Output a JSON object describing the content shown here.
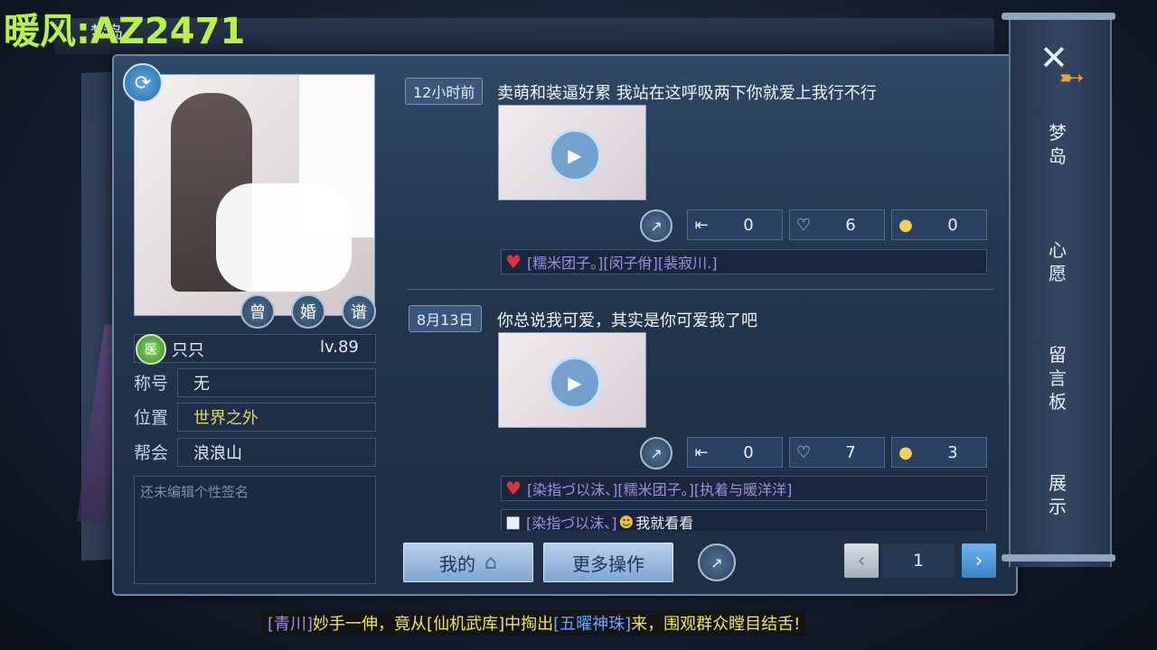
{
  "watermark": "暖风:AZ2471",
  "top_tab": "梦岛",
  "profile": {
    "sync_icon": "refresh-icon",
    "photo_buttons": [
      "曾",
      "婚",
      "谱"
    ],
    "name": "只只",
    "school_badge": "医",
    "level": "lv.89",
    "title_label": "称号",
    "title_value": "无",
    "location_label": "位置",
    "location_value": "世界之外",
    "guild_label": "帮会",
    "guild_value": "浪浪山",
    "signature_placeholder": "还未编辑个性签名"
  },
  "posts": [
    {
      "time": "12小时前",
      "text": "卖萌和装逼好累 我站在这呼吸两下你就爱上我行不行",
      "stats": {
        "forward": "0",
        "likes": "6",
        "comments": "0"
      },
      "liked_by": "[糯米团子。][闵子佾][裴寂川.]"
    },
    {
      "time": "8月13日",
      "text": "你总说我可爱，其实是你可爱我了吧",
      "stats": {
        "forward": "0",
        "likes": "7",
        "comments": "3"
      },
      "liked_by": "[染指づ以沫、][糯米团子。][执着与暖洋洋]",
      "comment_name": "[染指づ以沫、]",
      "comment_text": "我就看看"
    }
  ],
  "bottom": {
    "my_button": "我的",
    "more_button": "更多操作",
    "page": "1"
  },
  "sidebar": {
    "items": [
      "梦岛",
      "心愿",
      "留言板",
      "展示"
    ]
  },
  "ticker": {
    "player": "[青川]",
    "text1": "妙手一伸，竟从",
    "place": "[仙机武库]",
    "text2": "中掏出",
    "item": "[五曜神珠]",
    "text3": "来，围观群众瞠目结舌!"
  }
}
